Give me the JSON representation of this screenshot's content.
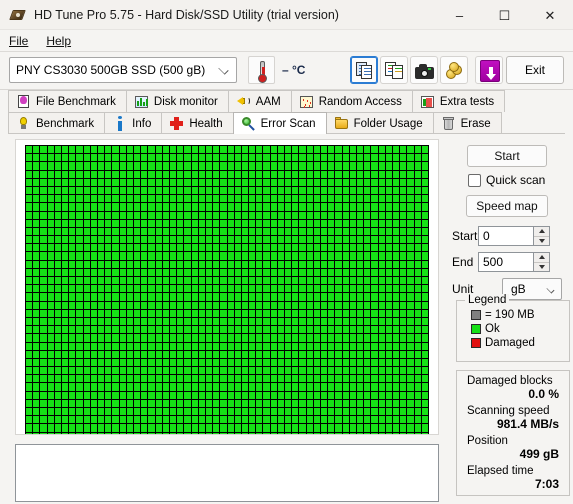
{
  "window": {
    "title": "HD Tune Pro 5.75 - Hard Disk/SSD Utility (trial version)",
    "minimize": "–",
    "maximize": "☐",
    "close": "✕"
  },
  "menu": {
    "items": [
      {
        "label": "File"
      },
      {
        "label": "Help"
      }
    ]
  },
  "toolbar": {
    "drive_value": "PNY CS3030 500GB SSD (500 gB)",
    "temperature": "– °C",
    "exit_label": "Exit",
    "icons": [
      {
        "name": "copy-icon"
      },
      {
        "name": "copy-color-icon"
      },
      {
        "name": "camera-icon"
      },
      {
        "name": "coins-icon"
      },
      {
        "name": "download-icon"
      }
    ]
  },
  "tabs": {
    "row1": [
      {
        "label": "File Benchmark",
        "icon": "file-benchmark-icon",
        "selected": false
      },
      {
        "label": "Disk monitor",
        "icon": "disk-monitor-icon",
        "selected": false
      },
      {
        "label": "AAM",
        "icon": "speaker-icon",
        "selected": false
      },
      {
        "label": "Random Access",
        "icon": "random-access-icon",
        "selected": false
      },
      {
        "label": "Extra tests",
        "icon": "extra-tests-icon",
        "selected": false
      }
    ],
    "row2": [
      {
        "label": "Benchmark",
        "icon": "bulb-icon",
        "selected": false
      },
      {
        "label": "Info",
        "icon": "info-icon",
        "selected": false
      },
      {
        "label": "Health",
        "icon": "health-cross-icon",
        "selected": false
      },
      {
        "label": "Error Scan",
        "icon": "magnifier-icon",
        "selected": true
      },
      {
        "label": "Folder Usage",
        "icon": "folder-icon",
        "selected": false
      },
      {
        "label": "Erase",
        "icon": "trash-icon",
        "selected": false
      }
    ]
  },
  "panel": {
    "start_button": "Start",
    "quick_scan_label": "Quick scan",
    "quick_scan_checked": false,
    "speed_map_button": "Speed map",
    "start_label": "Start",
    "start_value": "0",
    "end_label": "End",
    "end_value": "500",
    "unit_label": "Unit",
    "unit_value": "gB"
  },
  "legend": {
    "title": "Legend",
    "block_size": "= 190 MB",
    "ok_label": "Ok",
    "damaged_label": "Damaged",
    "colors": {
      "block": "#808080",
      "ok": "#16e016",
      "damaged": "#e01010"
    }
  },
  "stats": {
    "damaged_blocks_label": "Damaged blocks",
    "damaged_blocks_value": "0.0 %",
    "scanning_speed_label": "Scanning speed",
    "scanning_speed_value": "981.4 MB/s",
    "position_label": "Position",
    "position_value": "499 gB",
    "elapsed_label": "Elapsed time",
    "elapsed_value": "7:03"
  },
  "blockmap": {
    "columns": 56,
    "rows": 40,
    "total_cells": 2217,
    "all_state": "ok"
  },
  "log": {
    "text": ""
  }
}
